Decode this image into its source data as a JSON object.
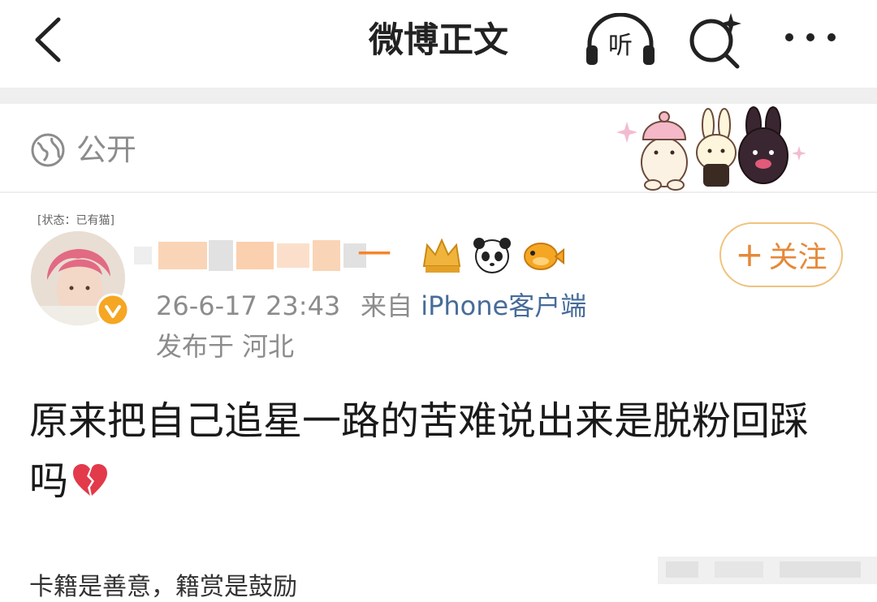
{
  "header": {
    "title": "微博正文",
    "back_icon": "chevron-left-icon",
    "listen_label": "听",
    "search_icon": "search-sparkle-icon",
    "more_icon": "more-dots-icon"
  },
  "visibility": {
    "label": "公开",
    "icon": "globe-icon"
  },
  "user": {
    "status_tag": "[状态：已有猫]",
    "name_visible": "一",
    "verified_icon": "verified-badge-icon",
    "badges": [
      "crown-badge-icon",
      "panda-icon",
      "pufferfish-icon"
    ]
  },
  "meta": {
    "time": "26-6-17 23:43",
    "source_prefix": "来自",
    "source": "iPhone客户端",
    "location": "发布于 河北"
  },
  "follow": {
    "plus": "+",
    "label": "关注"
  },
  "post": {
    "text": "原来把自己追星一路的苦难说出来是脱粉回踩吗",
    "emoji": "broken-heart-icon"
  },
  "bottom": {
    "text": "卡籍是善意，籍赏是鼓励"
  },
  "colors": {
    "accent": "#f5852a",
    "link": "#476c99",
    "muted": "#8c8c8c"
  }
}
